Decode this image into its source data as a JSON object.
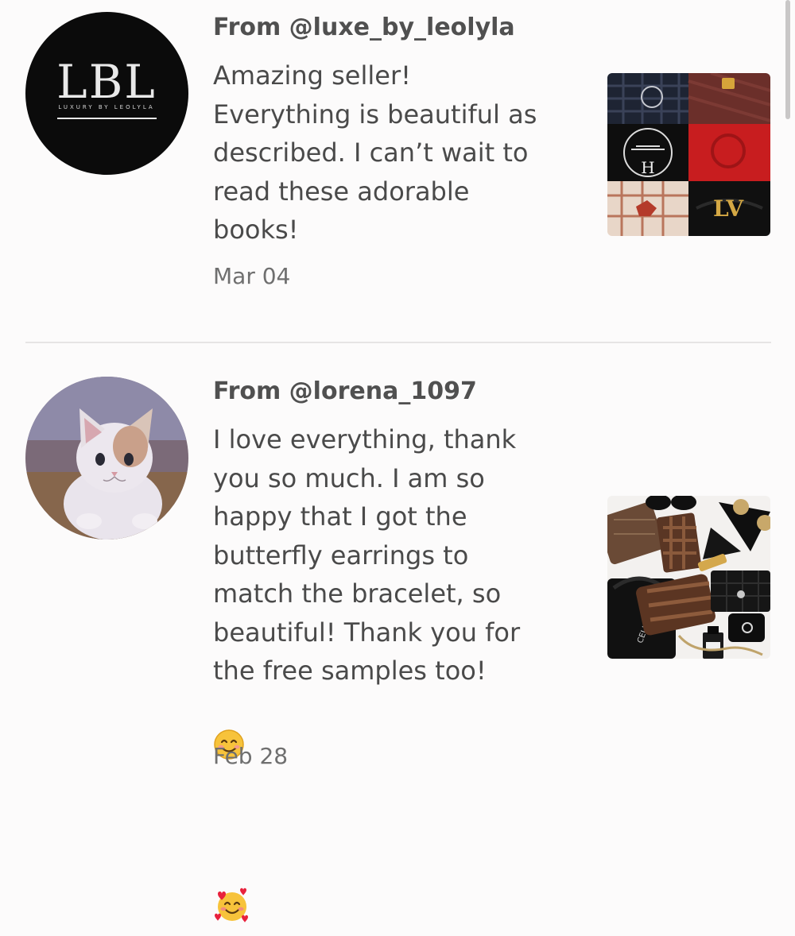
{
  "reviews": [
    {
      "author": "From @luxe_by_leolyla",
      "text": "Amazing seller!\nEverything is beautiful as\ndescribed. I can’t wait to\nread these adorable\nbooks!",
      "date": "Mar 04",
      "avatar": {
        "type": "logo",
        "monogram": "LBL",
        "tagline": "LUXURY BY LEOLYLA"
      },
      "thumbnail": "handbag-collage"
    },
    {
      "author": "From @lorena_1097",
      "text": "I love everything, thank\nyou so much. I am so\nhappy that I got the\nbutterfly earrings to\nmatch the bracelet, so\nbeautiful! Thank you for\nthe free samples too!",
      "emoji_inline": "smiling-face-icon",
      "emoji_next_line": "smiling-face-with-hearts-icon",
      "date": "Feb 28",
      "avatar": {
        "type": "photo",
        "subject": "cat"
      },
      "thumbnail": "luxury-accessories-flatlay"
    }
  ],
  "colors": {
    "background": "#fcfbfb",
    "text": "#4a4a4a",
    "date": "#6f6f6f",
    "divider": "#e6e4e4"
  }
}
